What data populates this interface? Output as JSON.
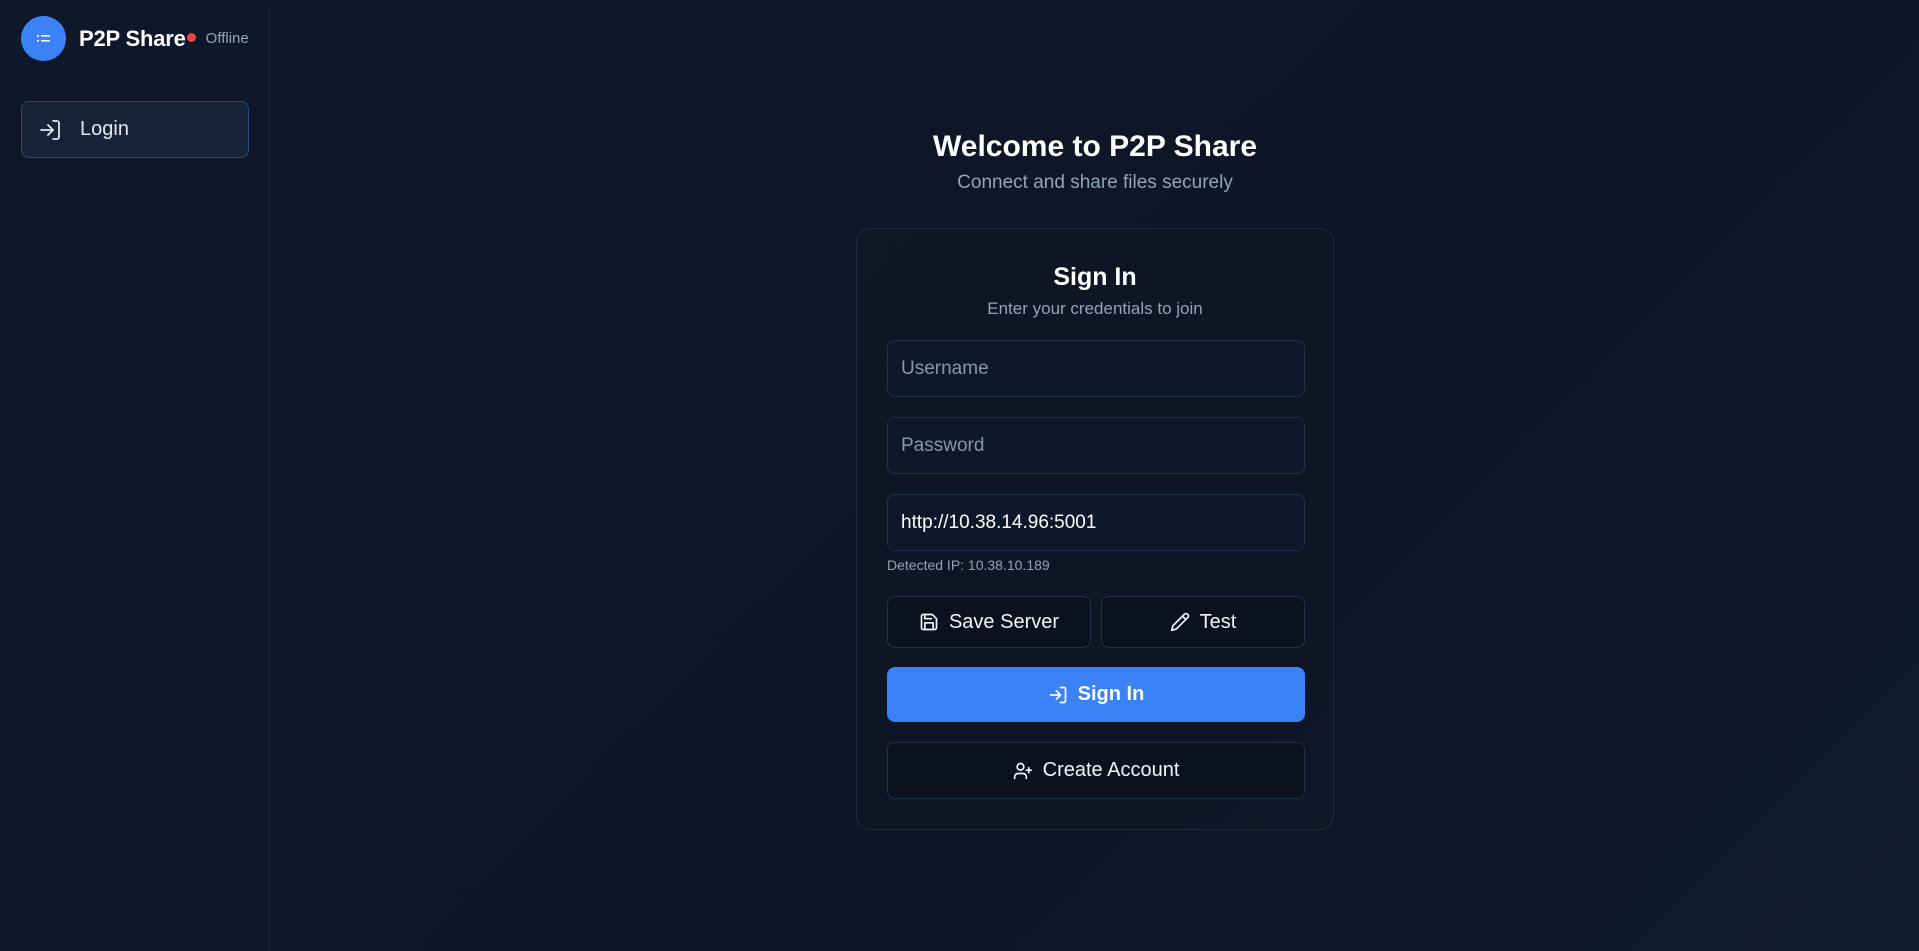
{
  "app": {
    "name": "P2P Share",
    "status": "Offline",
    "status_color": "#ef4444",
    "accent_color": "#3b82f6"
  },
  "sidebar": {
    "items": [
      {
        "label": "Login",
        "icon": "login-icon"
      }
    ]
  },
  "main": {
    "title": "Welcome to P2P Share",
    "subtitle": "Connect and share files securely"
  },
  "card": {
    "title": "Sign In",
    "subtitle": "Enter your credentials to join",
    "username": {
      "placeholder": "Username",
      "value": ""
    },
    "password": {
      "placeholder": "Password",
      "value": ""
    },
    "server": {
      "value": "http://10.38.14.96:5001"
    },
    "detected_ip": "Detected IP: 10.38.10.189",
    "save_server_label": "Save Server",
    "test_label": "Test",
    "sign_in_label": "Sign In",
    "create_account_label": "Create Account"
  }
}
